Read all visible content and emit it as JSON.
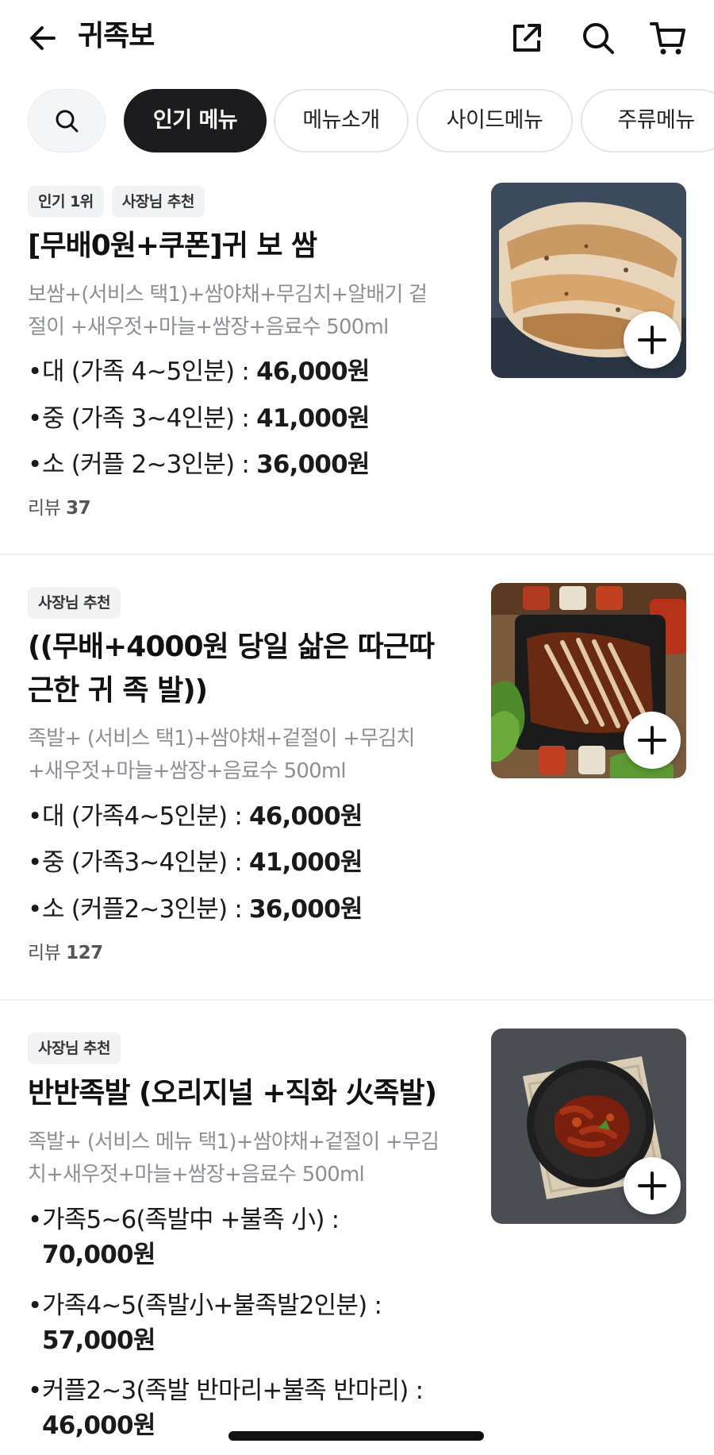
{
  "header": {
    "title": "귀족보",
    "icons": [
      "back-arrow-icon",
      "share-icon",
      "search-icon",
      "cart-icon"
    ]
  },
  "tabs": [
    {
      "label": "인기 메뉴",
      "active": true
    },
    {
      "label": "메뉴소개",
      "active": false
    },
    {
      "label": "사이드메뉴",
      "active": false
    },
    {
      "label": "주류메뉴",
      "active": false
    }
  ],
  "items": [
    {
      "badges": [
        "인기 1위",
        "사장님 추천"
      ],
      "name": "[무배0원+쿠폰]귀 보 쌈",
      "desc_lines": [
        "보쌈+(서비스  택1)+쌈야채+무김치+알배기 겉",
        "절이 +새우젓+마늘+쌈장+음료수 500ml"
      ],
      "prices": [
        {
          "label": "대 (가족 4~5인분) : ",
          "amount": "46,000원"
        },
        {
          "label": "중 (가족 3~4인분) : ",
          "amount": "41,000원"
        },
        {
          "label": "소 (커플 2~3인분) : ",
          "amount": "36,000원"
        }
      ],
      "review_label": "리뷰",
      "review_count": "37",
      "image": "boiled-pork-bossam-photo"
    },
    {
      "badges": [
        "사장님 추천"
      ],
      "name_lines": [
        "((무배+4000원 당일 삶은 따근따",
        "근한 귀 족 발))"
      ],
      "desc_lines": [
        "족발+ (서비스 택1)+쌈야채+겉절이 +무김치",
        "+새우젓+마늘+쌈장+음료수 500ml"
      ],
      "prices": [
        {
          "label": "대 (가족4~5인분) : ",
          "amount": "46,000원"
        },
        {
          "label": "중 (가족3~4인분) : ",
          "amount": "41,000원"
        },
        {
          "label": "소 (커플2~3인분) : ",
          "amount": "36,000원"
        }
      ],
      "review_label": "리뷰",
      "review_count": "127",
      "image": "jokbal-platter-photo"
    },
    {
      "badges": [
        "사장님 추천"
      ],
      "name": "반반족발 (오리지널 +직화 火족발)",
      "desc_lines": [
        "족발+ (서비스 메뉴 택1)+쌈야채+겉절이 +무김",
        "치+새우젓+마늘+쌈장+음료수 500ml"
      ],
      "prices": [
        {
          "label": "가족5~6(족발中 +불족 小) :",
          "amount": "70,000원"
        },
        {
          "label": "가족4~5(족발小+불족발2인분) :",
          "amount": "57,000원"
        },
        {
          "label": "커플2~3(족발 반마리+불족 반마리) :",
          "amount": "46,000원"
        }
      ],
      "image": "spicy-jokbal-bowl-photo"
    }
  ],
  "colors": {
    "active_tab_bg": "#1c1c1e",
    "desc_text": "#8c8f94",
    "badge_bg": "#f1f2f4"
  }
}
